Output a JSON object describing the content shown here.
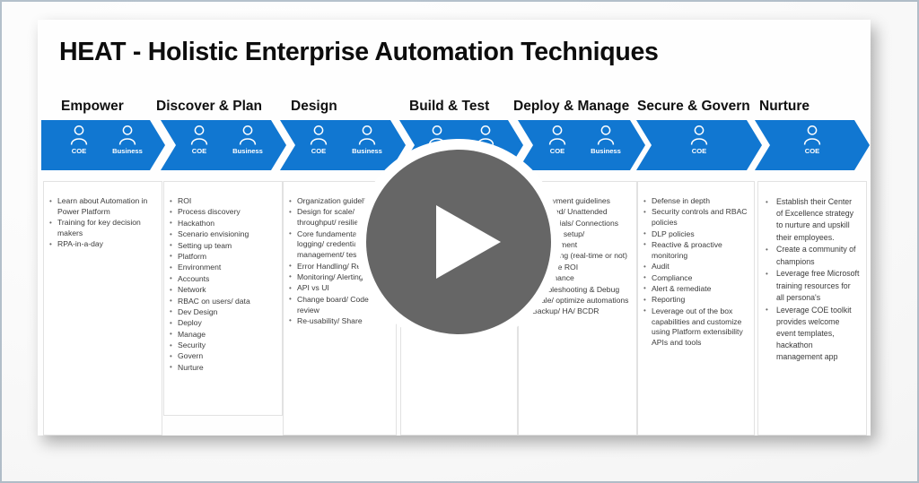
{
  "slide": {
    "title": "HEAT - Holistic Enterprise Automation Techniques",
    "accent_color": "#1177d1",
    "title_color": "#0d0d0d",
    "card_border_color": "#e2e2e2",
    "body_text_color": "#3b3b3b"
  },
  "play_overlay": {
    "icon": "play-triangle-icon",
    "circle_color": "#666666",
    "halo_color": "#ffffff",
    "triangle_color": "#ffffff"
  },
  "stages": [
    {
      "label": "Empower",
      "personas": [
        {
          "label": "COE",
          "icon": "person-icon"
        },
        {
          "label": "Business",
          "icon": "person-icon"
        }
      ],
      "bullets": [
        "Learn about Automation in Power Platform",
        "Training for key decision makers",
        "RPA-in-a-day"
      ]
    },
    {
      "label": "Discover & Plan",
      "personas": [
        {
          "label": "COE",
          "icon": "person-icon"
        },
        {
          "label": "Business",
          "icon": "person-icon"
        }
      ],
      "bullets": [
        "ROI",
        "Process discovery",
        "Hackathon",
        "Scenario envisioning",
        "Setting up team",
        "Platform",
        "Environment",
        "Accounts",
        "Network",
        "RBAC on users/ data",
        "Dev Design",
        "Deploy",
        "Manage",
        "Security",
        "Govern",
        "Nurture"
      ]
    },
    {
      "label": "Design",
      "personas": [
        {
          "label": "COE",
          "icon": "person-icon"
        },
        {
          "label": "Business",
          "icon": "person-icon"
        }
      ],
      "bullets": [
        "Organization guidelines",
        "Design for scale/ throughput/ resilience",
        "Core fundamentals: logging/ credential management/ testing",
        "Error Handling/ Retry",
        "Monitoring/ Alerting",
        "API vs UI",
        "Change board/ Code review",
        "Re-usability/ Share"
      ]
    },
    {
      "label": "Build & Test",
      "personas": [
        {
          "label": "COE",
          "icon": "person-icon"
        },
        {
          "label": "Business",
          "icon": "person-icon"
        }
      ],
      "bullets": []
    },
    {
      "label": "Deploy & Manage",
      "personas": [
        {
          "label": "COE",
          "icon": "person-icon"
        },
        {
          "label": "Business",
          "icon": "person-icon"
        }
      ],
      "bullets": [
        "Deployment guidelines",
        "Attended/ Unattended",
        "Credentials/ Connections",
        "Machine setup/ management",
        "Monitoring (real-time or not)",
        "Measure ROI",
        "Governance",
        "Troubleshooting & Debug",
        "Scale/ optimize automations",
        "Backup/ HA/ BCDR"
      ]
    },
    {
      "label": "Secure & Govern",
      "personas": [
        {
          "label": "COE",
          "icon": "person-icon"
        }
      ],
      "bullets": [
        "Defense in depth",
        "Security controls and RBAC policies",
        "DLP policies",
        "Reactive & proactive monitoring",
        "Audit",
        "Compliance",
        "Alert & remediate",
        "Reporting",
        "Leverage out of the box capabilities and customize using Platform extensibility APIs and tools"
      ]
    },
    {
      "label": "Nurture",
      "personas": [
        {
          "label": "COE",
          "icon": "person-icon"
        }
      ],
      "bullets": [
        "Establish their Center of Excellence strategy to nurture and upskill their employees.",
        "Create a community of champions",
        "Leverage free Microsoft training resources for all persona's",
        "Leverage COE toolkit provides welcome event templates, hackathon management app"
      ]
    }
  ]
}
